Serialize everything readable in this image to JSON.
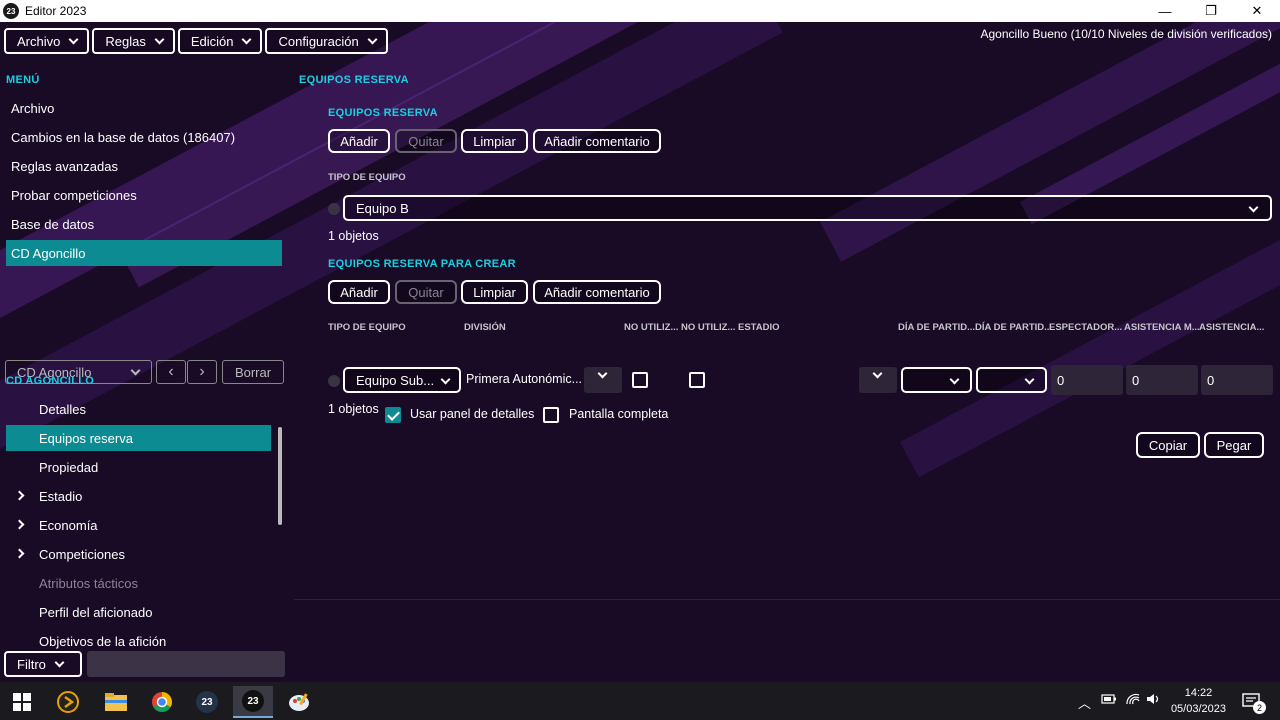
{
  "window": {
    "title": "Editor 2023",
    "icon_text": "23",
    "minimize": "—",
    "maximize": "❐",
    "close": "✕"
  },
  "menubar": [
    {
      "label": "Archivo"
    },
    {
      "label": "Reglas"
    },
    {
      "label": "Edición"
    },
    {
      "label": "Configuración"
    }
  ],
  "status_top": "Agoncillo Bueno (10/10 Niveles de división verificados)",
  "menu": {
    "heading": "MENÚ",
    "items": [
      {
        "label": "Archivo"
      },
      {
        "label": "Cambios en la base de datos (186407)"
      },
      {
        "label": "Reglas avanzadas"
      },
      {
        "label": "Probar competiciones"
      },
      {
        "label": "Base de datos"
      },
      {
        "label": "CD Agoncillo",
        "active": true
      }
    ]
  },
  "nav": {
    "combo_value": "CD Agoncillo",
    "prev": "‹",
    "next": "›",
    "clear_label": "Borrar"
  },
  "tree": {
    "heading": "CD AGONCILLO",
    "items": [
      {
        "label": "Detalles"
      },
      {
        "label": "Equipos reserva",
        "active": true
      },
      {
        "label": "Propiedad"
      },
      {
        "label": "Estadio",
        "expandable": true
      },
      {
        "label": "Economía",
        "expandable": true
      },
      {
        "label": "Competiciones",
        "expandable": true
      },
      {
        "label": "Atributos tácticos",
        "disabled": true
      },
      {
        "label": "Perfil del aficionado"
      },
      {
        "label": "Objetivos de la afición"
      }
    ]
  },
  "filter": {
    "label": "Filtro",
    "value": ""
  },
  "main": {
    "title": "EQUIPOS RESERVA",
    "section1": {
      "heading": "EQUIPOS RESERVA",
      "buttons": {
        "add": "Añadir",
        "remove": "Quitar",
        "clear": "Limpiar",
        "comment": "Añadir comentario"
      },
      "column": "TIPO DE EQUIPO",
      "selected": "Equipo B",
      "count": "1 objetos"
    },
    "section2": {
      "heading": "EQUIPOS RESERVA PARA CREAR",
      "buttons": {
        "add": "Añadir",
        "remove": "Quitar",
        "clear": "Limpiar",
        "comment": "Añadir comentario"
      },
      "columns": {
        "team_type": "TIPO DE EQUIPO",
        "division": "DIVISIÓN",
        "not_used_1": "NO UTILIZ...",
        "not_used_2": "NO UTILIZ...",
        "stadium": "ESTADIO",
        "match_day_1": "DÍA DE PARTID...",
        "match_day_2": "DÍA DE PARTID...",
        "spectators": "ESPECTADOR...",
        "attendance_1": "ASISTENCIA M...",
        "attendance_2": "ASISTENCIA..."
      },
      "row": {
        "team_type": "Equipo Sub...",
        "division": "Primera Autonómic...",
        "spectators": "0",
        "attendance_1": "0",
        "attendance_2": "0"
      },
      "count": "1 objetos",
      "use_details_panel": "Usar panel de detalles",
      "fullscreen": "Pantalla completa"
    },
    "copy_label": "Copiar",
    "paste_label": "Pegar"
  },
  "taskbar": {
    "time": "14:22",
    "date": "05/03/2023",
    "notifications": "2",
    "app_badge": "23"
  }
}
